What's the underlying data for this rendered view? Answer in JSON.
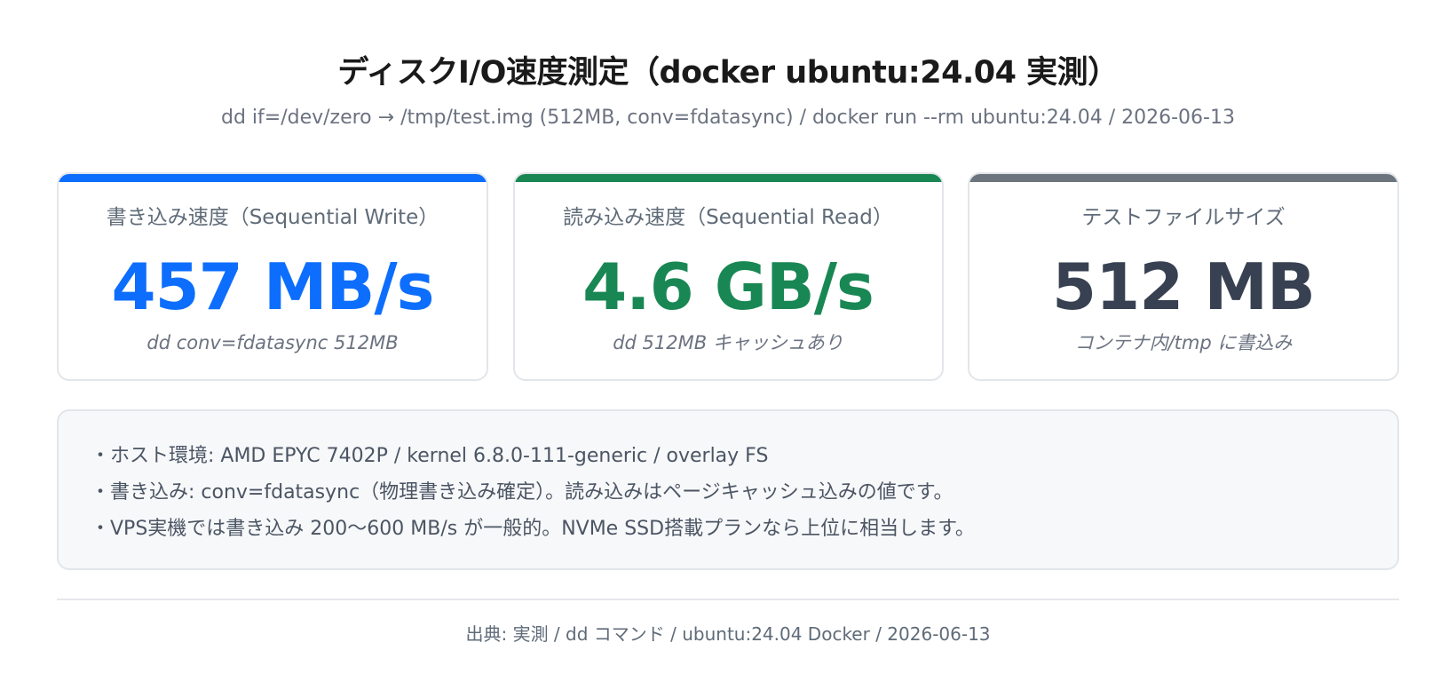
{
  "header": {
    "title": "ディスクI/O速度測定（docker ubuntu:24.04 実測）",
    "subtitle": "dd if=/dev/zero → /tmp/test.img (512MB, conv=fdatasync) / docker run --rm ubuntu:24.04 / 2026-06-13"
  },
  "cards": [
    {
      "label": "書き込み速度（Sequential Write）",
      "value": "457 MB/s",
      "note": "dd conv=fdatasync 512MB",
      "accent_color": "#0d6efd"
    },
    {
      "label": "読み込み速度（Sequential Read）",
      "value": "4.6 GB/s",
      "note": "dd 512MB キャッシュあり",
      "accent_color": "#198754"
    },
    {
      "label": "テストファイルサイズ",
      "value": "512 MB",
      "note": "コンテナ内/tmp に書込み",
      "accent_color": "#6c757d",
      "value_color": "#374151"
    }
  ],
  "notes": [
    "・ホスト環境: AMD EPYC 7402P / kernel 6.8.0-111-generic / overlay FS",
    "・書き込み: conv=fdatasync（物理書き込み確定）。読み込みはページキャッシュ込みの値です。",
    "・VPS実機では書き込み 200〜600 MB/s が一般的。NVMe SSD搭載プランなら上位に相当します。"
  ],
  "footer": {
    "source": "出典: 実測 / dd コマンド / ubuntu:24.04 Docker / 2026-06-13"
  }
}
